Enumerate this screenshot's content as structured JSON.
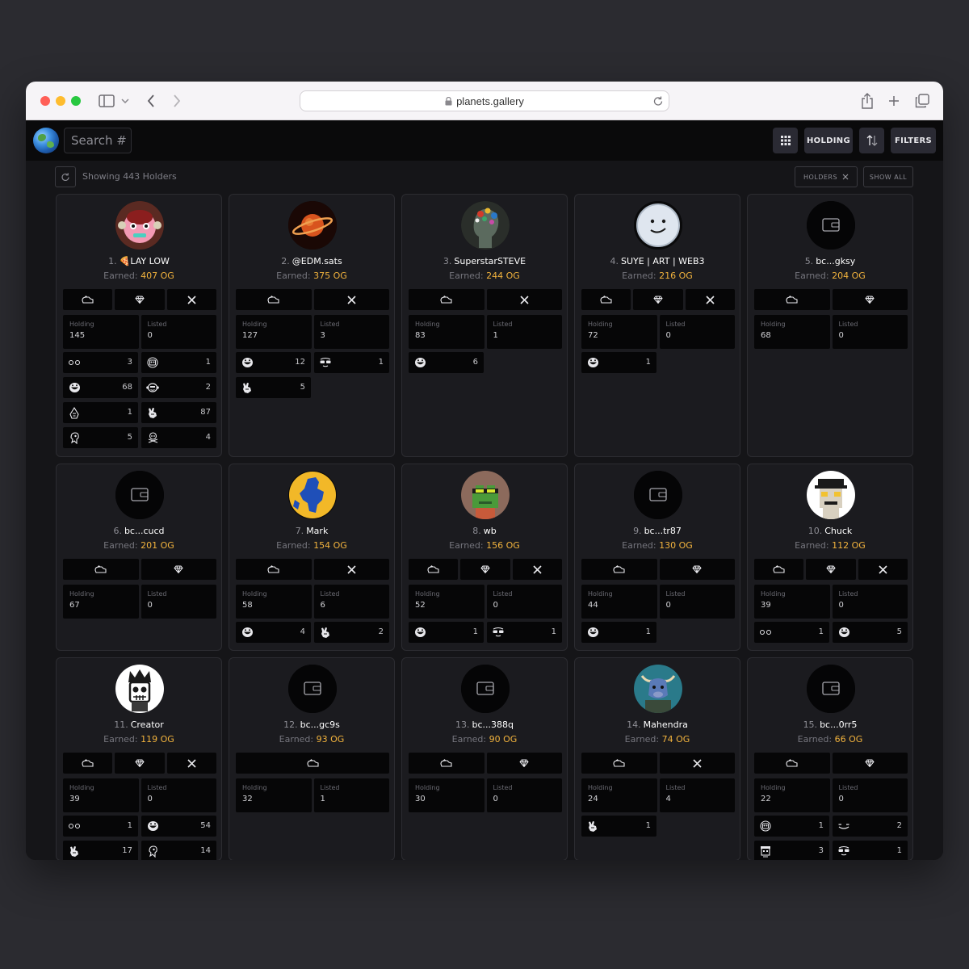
{
  "browser": {
    "url": "planets.gallery"
  },
  "toolbar": {
    "search_placeholder": "Search #",
    "holding_label": "HOLDING",
    "filters_label": "FILTERS"
  },
  "subbar": {
    "showing_text": "Showing 443 Holders",
    "holders_pill": "HOLDERS",
    "show_all": "SHOW ALL"
  },
  "labels": {
    "holding": "Holding",
    "listed": "Listed",
    "earned": "Earned:"
  },
  "holders": [
    {
      "rank": "1.",
      "name": "LAY LOW",
      "emoji": "🍕",
      "earned": "407 OG",
      "holding": "145",
      "listed": "0",
      "avatar": "pink-creature",
      "buttons": [
        "wallet",
        "gem",
        "x"
      ],
      "traits": [
        [
          "dots",
          "3"
        ],
        [
          "skull-box",
          "1"
        ],
        [
          "grin-face",
          "68"
        ],
        [
          "monkey-face",
          "2"
        ],
        [
          "hooded-figure",
          "1"
        ],
        [
          "hand-peace",
          "87"
        ],
        [
          "ghost-claw",
          "5"
        ],
        [
          "crossbones",
          "4"
        ]
      ]
    },
    {
      "rank": "2.",
      "name": "@EDM.sats",
      "earned": "375 OG",
      "holding": "127",
      "listed": "3",
      "avatar": "saturn",
      "buttons": [
        "wallet",
        "x"
      ],
      "traits": [
        [
          "grin-face",
          "12"
        ],
        [
          "sunglasses",
          "1"
        ],
        [
          "hand-peace",
          "5"
        ]
      ]
    },
    {
      "rank": "3.",
      "name": "SuperstarSTEVE",
      "earned": "244 OG",
      "holding": "83",
      "listed": "1",
      "avatar": "jeweled-head",
      "buttons": [
        "wallet",
        "x"
      ],
      "traits": [
        [
          "grin-face",
          "6"
        ]
      ]
    },
    {
      "rank": "4.",
      "name": "SUYE | ART | WEB3",
      "earned": "216 OG",
      "holding": "72",
      "listed": "0",
      "avatar": "moon-smile",
      "buttons": [
        "wallet",
        "gem",
        "x"
      ],
      "traits": [
        [
          "grin-face",
          "1"
        ]
      ]
    },
    {
      "rank": "5.",
      "name": "bc...gksy",
      "earned": "204 OG",
      "holding": "68",
      "listed": "0",
      "avatar": "wallet",
      "buttons": [
        "wallet",
        "gem"
      ],
      "traits": []
    },
    {
      "rank": "6.",
      "name": "bc...cucd",
      "earned": "201 OG",
      "holding": "67",
      "listed": "0",
      "avatar": "wallet",
      "buttons": [
        "wallet",
        "gem"
      ],
      "traits": []
    },
    {
      "rank": "7.",
      "name": "Mark",
      "earned": "154 OG",
      "holding": "58",
      "listed": "6",
      "avatar": "map-planet",
      "buttons": [
        "wallet",
        "x"
      ],
      "traits": [
        [
          "grin-face",
          "4"
        ],
        [
          "hand-peace",
          "2"
        ]
      ]
    },
    {
      "rank": "8.",
      "name": "wb",
      "earned": "156 OG",
      "holding": "52",
      "listed": "0",
      "avatar": "frog",
      "buttons": [
        "wallet",
        "gem",
        "x"
      ],
      "traits": [
        [
          "grin-face",
          "1"
        ],
        [
          "sunglasses",
          "1"
        ]
      ]
    },
    {
      "rank": "9.",
      "name": "bc...tr87",
      "earned": "130 OG",
      "holding": "44",
      "listed": "0",
      "avatar": "wallet",
      "buttons": [
        "wallet",
        "gem"
      ],
      "traits": [
        [
          "grin-face",
          "1"
        ]
      ]
    },
    {
      "rank": "10.",
      "name": "Chuck",
      "earned": "112 OG",
      "holding": "39",
      "listed": "0",
      "avatar": "pixel-ape",
      "buttons": [
        "wallet",
        "gem",
        "x"
      ],
      "traits": [
        [
          "dots",
          "1"
        ],
        [
          "grin-face",
          "5"
        ]
      ]
    },
    {
      "rank": "11.",
      "name": "Creator",
      "earned": "119 OG",
      "holding": "39",
      "listed": "0",
      "avatar": "crown-skull",
      "buttons": [
        "wallet",
        "gem",
        "x"
      ],
      "traits": [
        [
          "dots",
          "1"
        ],
        [
          "grin-face",
          "54"
        ],
        [
          "hand-peace",
          "17"
        ],
        [
          "ghost-claw",
          "14"
        ]
      ]
    },
    {
      "rank": "12.",
      "name": "bc...gc9s",
      "earned": "93 OG",
      "holding": "32",
      "listed": "1",
      "avatar": "wallet",
      "buttons": [
        "wallet"
      ],
      "traits": []
    },
    {
      "rank": "13.",
      "name": "bc...388q",
      "earned": "90 OG",
      "holding": "30",
      "listed": "0",
      "avatar": "wallet",
      "buttons": [
        "wallet",
        "gem"
      ],
      "traits": []
    },
    {
      "rank": "14.",
      "name": "Mahendra",
      "earned": "74 OG",
      "holding": "24",
      "listed": "4",
      "avatar": "bull",
      "buttons": [
        "wallet",
        "x"
      ],
      "traits": [
        [
          "hand-peace",
          "1"
        ]
      ]
    },
    {
      "rank": "15.",
      "name": "bc...0rr5",
      "earned": "66 OG",
      "holding": "22",
      "listed": "0",
      "avatar": "wallet",
      "buttons": [
        "wallet",
        "gem"
      ],
      "traits": [
        [
          "skull-box",
          "1"
        ],
        [
          "smirk",
          "2"
        ],
        [
          "robot-head",
          "3"
        ],
        [
          "sunglasses",
          "1"
        ]
      ]
    }
  ],
  "colors": {
    "accent_earned": "#f2b33d",
    "card_bg": "#1b1b1f",
    "page_bg": "#151518"
  }
}
